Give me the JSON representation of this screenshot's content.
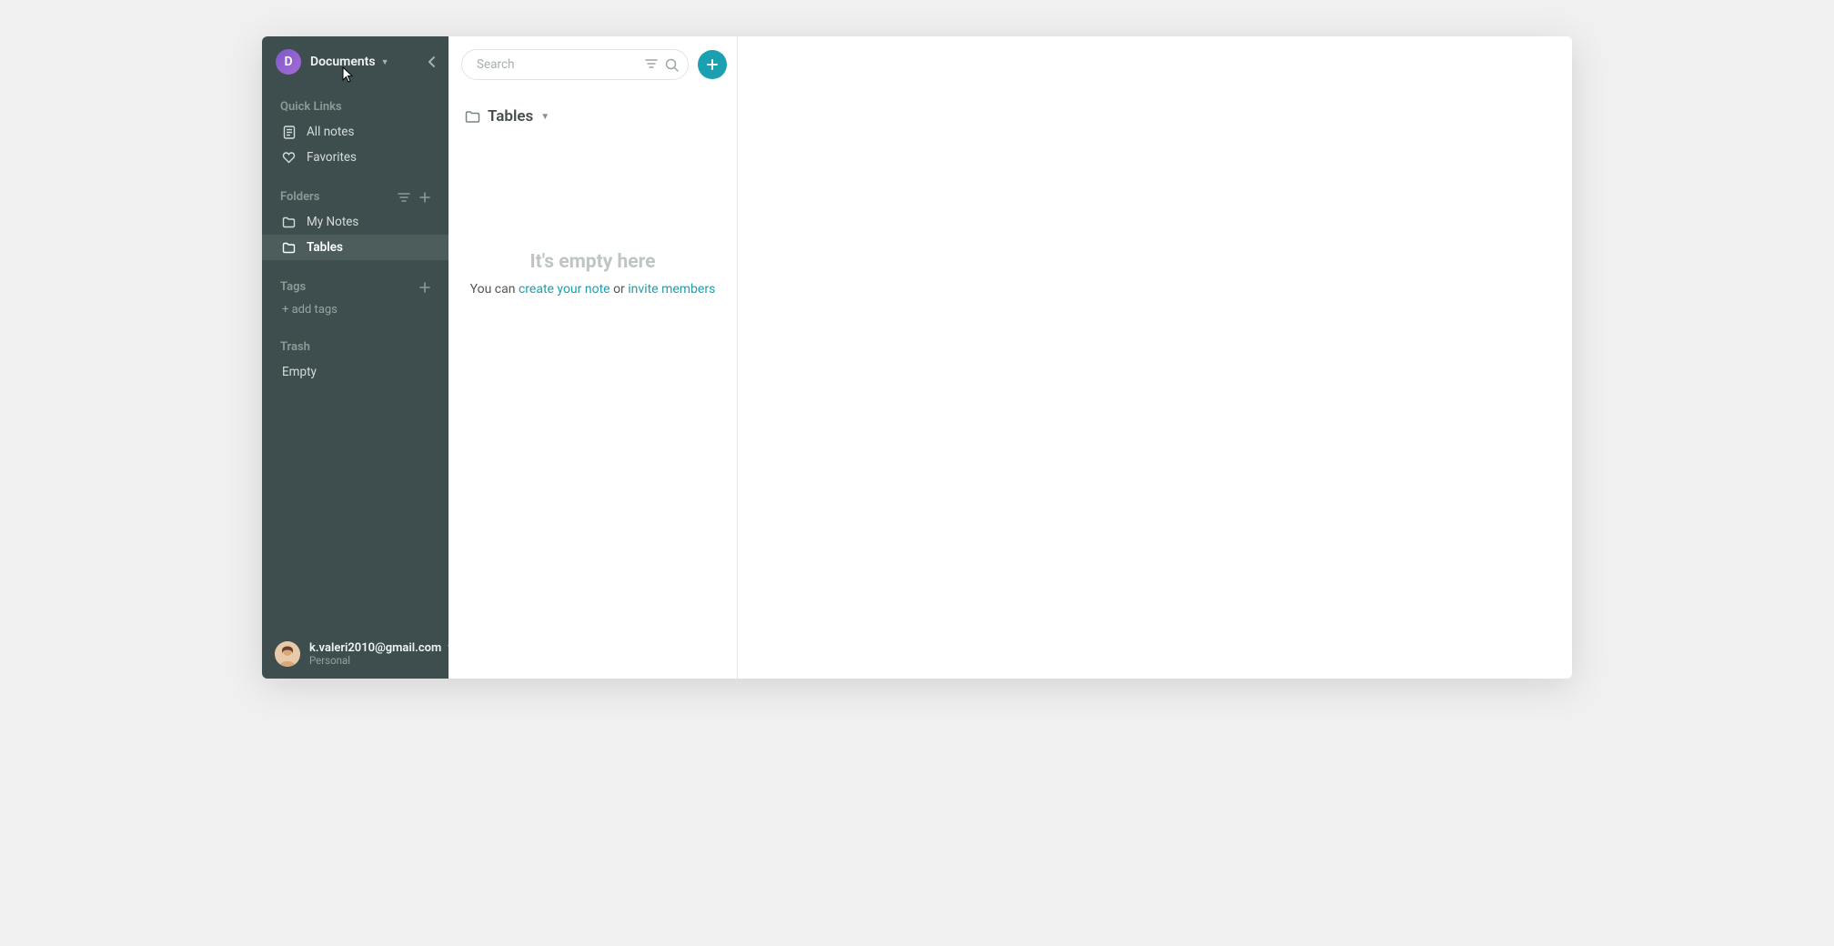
{
  "workspace": {
    "avatar_letter": "D",
    "title": "Documents"
  },
  "sidebar": {
    "quick_links_label": "Quick Links",
    "all_notes": "All notes",
    "favorites": "Favorites",
    "folders_label": "Folders",
    "folders": [
      {
        "label": "My Notes",
        "active": false
      },
      {
        "label": "Tables",
        "active": true
      }
    ],
    "tags_label": "Tags",
    "add_tags": "+ add tags",
    "trash_label": "Trash",
    "trash_empty": "Empty"
  },
  "user": {
    "email": "k.valeri2010@gmail.com",
    "plan": "Personal"
  },
  "mid": {
    "search_placeholder": "Search",
    "crumb": "Tables",
    "empty_title": "It's empty here",
    "empty_prefix": "You can ",
    "empty_link1": "create your note",
    "empty_sep": " or ",
    "empty_link2": "invite members"
  }
}
